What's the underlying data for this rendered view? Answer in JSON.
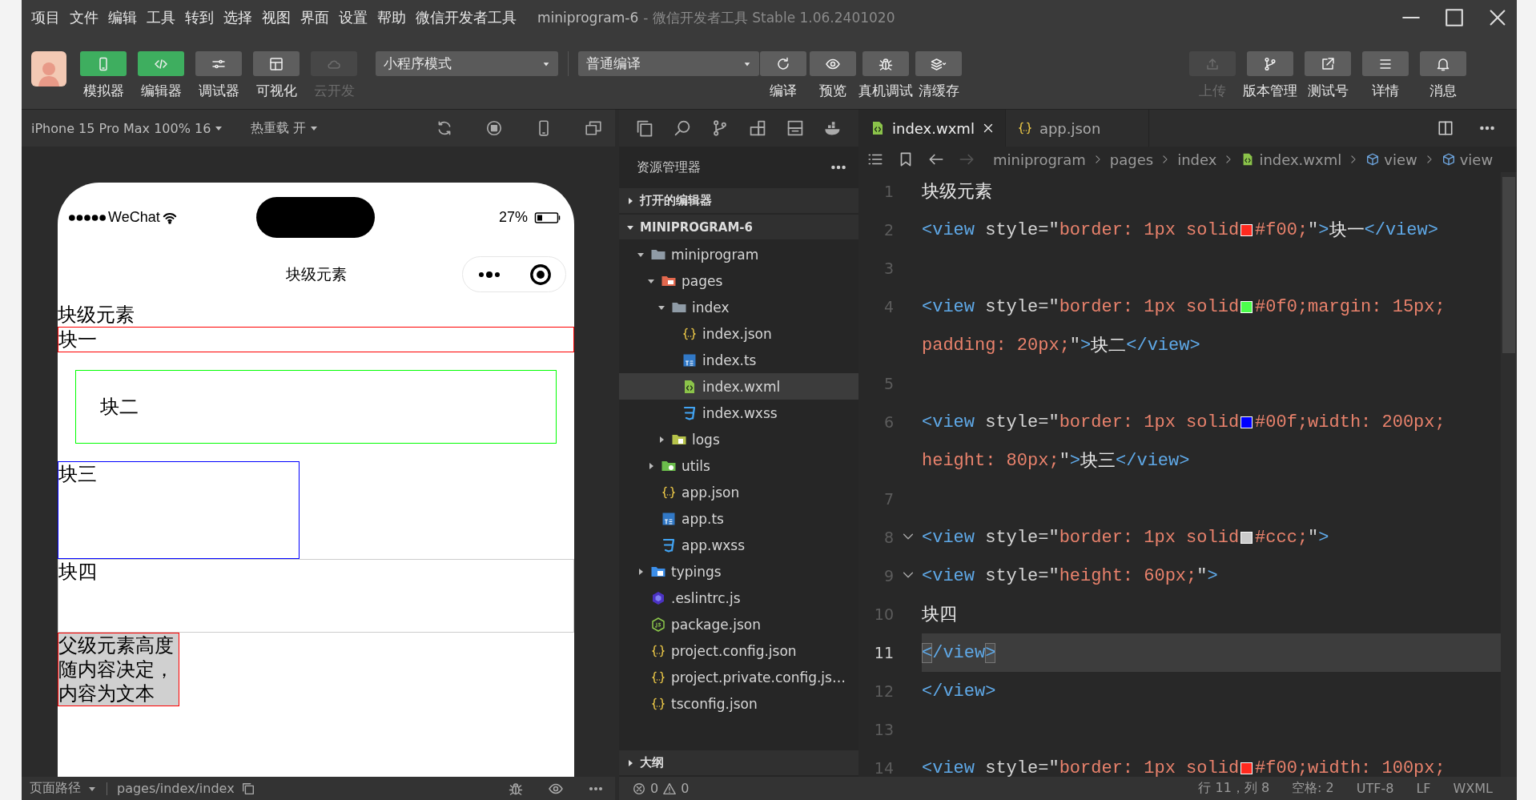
{
  "title_bar": {
    "menu": [
      "项目",
      "文件",
      "编辑",
      "工具",
      "转到",
      "选择",
      "视图",
      "界面",
      "设置",
      "帮助",
      "微信开发者工具"
    ],
    "project": "miniprogram-6",
    "app": "- 微信开发者工具 Stable 1.06.2401020"
  },
  "toolbar": {
    "view_buttons": [
      {
        "label": "模拟器",
        "kind": "phone",
        "selected": true,
        "disabled": false
      },
      {
        "label": "编辑器",
        "kind": "code",
        "selected": true,
        "disabled": false
      },
      {
        "label": "调试器",
        "kind": "debug",
        "selected": false,
        "disabled": false
      },
      {
        "label": "可视化",
        "kind": "layout",
        "selected": false,
        "disabled": false
      },
      {
        "label": "云开发",
        "kind": "cloud",
        "selected": false,
        "disabled": true
      }
    ],
    "mode": "小程序模式",
    "compile": "普通编译",
    "action_buttons": [
      {
        "label": "编译",
        "kind": "refresh"
      },
      {
        "label": "预览",
        "kind": "eye"
      },
      {
        "label": "真机调试",
        "kind": "bug"
      },
      {
        "label": "清缓存",
        "kind": "layers"
      }
    ],
    "right_buttons": [
      {
        "label": "上传",
        "kind": "upload",
        "disabled": true
      },
      {
        "label": "版本管理",
        "kind": "branch",
        "disabled": false
      },
      {
        "label": "测试号",
        "kind": "export",
        "disabled": false
      },
      {
        "label": "详情",
        "kind": "menu",
        "disabled": false
      },
      {
        "label": "消息",
        "kind": "bell",
        "disabled": false
      }
    ]
  },
  "simulator": {
    "device": "iPhone 15 Pro Max 100% 16",
    "hot_reload": "热重载 开",
    "carrier": "WeChat",
    "battery": "27%",
    "nav_title": "块级元素",
    "blocks": [
      {
        "kind": "plain",
        "text": "块级元素"
      },
      {
        "kind": "full",
        "text": "块一",
        "color": "#ff0000"
      },
      {
        "kind": "padded",
        "text": "块二",
        "color": "#00ff00"
      },
      {
        "kind": "fixed",
        "text": "块三",
        "color": "#0000ff"
      },
      {
        "kind": "tall",
        "text": "块四",
        "color": "#cccccc"
      },
      {
        "kind": "filled",
        "text": "父级元素高度随内容决定，内容为文本",
        "color": "#ff0000"
      }
    ],
    "path_label": "页面路径",
    "path": "pages/index/index"
  },
  "explorer": {
    "title": "资源管理器",
    "sections": [
      {
        "label": "打开的编辑器",
        "expanded": false
      },
      {
        "label": "MINIPROGRAM-6",
        "expanded": true,
        "children": [
          {
            "name": "miniprogram",
            "kind": "folder",
            "expanded": true,
            "selected": false,
            "children": [
              {
                "name": "pages",
                "kind": "pages",
                "expanded": true,
                "selected": false,
                "children": [
                  {
                    "name": "index",
                    "kind": "folder",
                    "expanded": true,
                    "selected": false,
                    "children": [
                      {
                        "name": "index.json",
                        "kind": "json",
                        "selected": false
                      },
                      {
                        "name": "index.ts",
                        "kind": "ts",
                        "selected": false
                      },
                      {
                        "name": "index.wxml",
                        "kind": "wxml",
                        "selected": true
                      },
                      {
                        "name": "index.wxss",
                        "kind": "wxss",
                        "selected": false
                      }
                    ]
                  },
                  {
                    "name": "logs",
                    "kind": "logs",
                    "expanded": false,
                    "selected": false
                  }
                ]
              },
              {
                "name": "utils",
                "kind": "utils",
                "expanded": false,
                "selected": false
              },
              {
                "name": "app.json",
                "kind": "json",
                "selected": false
              },
              {
                "name": "app.ts",
                "kind": "ts",
                "selected": false
              },
              {
                "name": "app.wxss",
                "kind": "wxss",
                "selected": false
              }
            ]
          },
          {
            "name": "typings",
            "kind": "typings",
            "expanded": false,
            "selected": false
          },
          {
            "name": ".eslintrc.js",
            "kind": "eslint",
            "selected": false
          },
          {
            "name": "package.json",
            "kind": "package",
            "selected": false
          },
          {
            "name": "project.config.json",
            "kind": "json",
            "selected": false
          },
          {
            "name": "project.private.config.js…",
            "kind": "json",
            "selected": false
          },
          {
            "name": "tsconfig.json",
            "kind": "json",
            "selected": false
          }
        ]
      }
    ],
    "outline": {
      "label": "大纲",
      "expanded": false
    },
    "errors": "0",
    "warnings": "0"
  },
  "editor": {
    "tabs": [
      {
        "label": "index.wxml",
        "kind": "wxml",
        "selected": true
      },
      {
        "label": "app.json",
        "kind": "json",
        "selected": false
      }
    ],
    "breadcrumb": [
      {
        "label": "miniprogram",
        "kind": "folder"
      },
      {
        "label": "pages",
        "kind": "folder"
      },
      {
        "label": "index",
        "kind": "folder"
      },
      {
        "label": "index.wxml",
        "kind": "wxml"
      },
      {
        "label": "view",
        "kind": "element"
      },
      {
        "label": "view",
        "kind": "element"
      }
    ],
    "lines": [
      {
        "number": "1",
        "current": false,
        "fold": false,
        "rows": [
          {
            "tokens": [
              {
                "kind": "text",
                "text": "块级元素"
              }
            ]
          }
        ]
      },
      {
        "number": "2",
        "current": false,
        "fold": false,
        "rows": [
          {
            "tokens": [
              {
                "kind": "tag",
                "text": "<view"
              },
              {
                "kind": "attr",
                "text": " style=\""
              },
              {
                "kind": "string",
                "text": "border: 1px solid"
              },
              {
                "kind": "swatch",
                "color": "#ff2a1f"
              },
              {
                "kind": "string",
                "text": "#f00;"
              },
              {
                "kind": "attr",
                "text": "\""
              },
              {
                "kind": "tag",
                "text": ">"
              },
              {
                "kind": "text",
                "text": "块一"
              },
              {
                "kind": "tag",
                "text": "</view>"
              }
            ]
          }
        ]
      },
      {
        "number": "3",
        "current": false,
        "fold": false
      },
      {
        "number": "4",
        "current": false,
        "fold": false,
        "rows": [
          {
            "tokens": [
              {
                "kind": "tag",
                "text": "<view"
              },
              {
                "kind": "attr",
                "text": " style=\""
              },
              {
                "kind": "string",
                "text": "border: 1px solid"
              },
              {
                "kind": "swatch",
                "color": "#4cff4c"
              },
              {
                "kind": "string",
                "text": "#0f0;margin: 15px;"
              }
            ]
          },
          {
            "tokens": [
              {
                "kind": "string",
                "text": "padding: 20px;"
              },
              {
                "kind": "attr",
                "text": "\""
              },
              {
                "kind": "tag",
                "text": ">"
              },
              {
                "kind": "text",
                "text": "块二"
              },
              {
                "kind": "tag",
                "text": "</view>"
              }
            ]
          }
        ]
      },
      {
        "number": "5",
        "current": false,
        "fold": false
      },
      {
        "number": "6",
        "current": false,
        "fold": false,
        "rows": [
          {
            "tokens": [
              {
                "kind": "tag",
                "text": "<view"
              },
              {
                "kind": "attr",
                "text": " style=\""
              },
              {
                "kind": "string",
                "text": "border: 1px solid"
              },
              {
                "kind": "swatch",
                "color": "#0000ff"
              },
              {
                "kind": "string",
                "text": "#00f;width: 200px;"
              }
            ]
          },
          {
            "tokens": [
              {
                "kind": "string",
                "text": "height: 80px;"
              },
              {
                "kind": "attr",
                "text": "\""
              },
              {
                "kind": "tag",
                "text": ">"
              },
              {
                "kind": "text",
                "text": "块三"
              },
              {
                "kind": "tag",
                "text": "</view>"
              }
            ]
          }
        ]
      },
      {
        "number": "7",
        "current": false,
        "fold": false
      },
      {
        "number": "8",
        "current": false,
        "fold": true,
        "rows": [
          {
            "tokens": [
              {
                "kind": "tag",
                "text": "<view"
              },
              {
                "kind": "attr",
                "text": " style=\""
              },
              {
                "kind": "string",
                "text": "border: 1px solid"
              },
              {
                "kind": "swatch",
                "color": "#cccccc"
              },
              {
                "kind": "string",
                "text": "#ccc;"
              },
              {
                "kind": "attr",
                "text": "\""
              },
              {
                "kind": "tag",
                "text": ">"
              }
            ]
          }
        ]
      },
      {
        "number": "9",
        "current": false,
        "fold": true,
        "rows": [
          {
            "tokens": [
              {
                "kind": "tag",
                "text": "<view"
              },
              {
                "kind": "attr",
                "text": " style=\""
              },
              {
                "kind": "string",
                "text": "height: 60px;"
              },
              {
                "kind": "attr",
                "text": "\""
              },
              {
                "kind": "tag",
                "text": ">"
              }
            ]
          }
        ]
      },
      {
        "number": "10",
        "current": false,
        "fold": false,
        "rows": [
          {
            "tokens": [
              {
                "kind": "text",
                "text": "块四"
              }
            ]
          }
        ]
      },
      {
        "number": "11",
        "current": true,
        "fold": false,
        "rows": [
          {
            "tokens": [
              {
                "kind": "tag",
                "text": "</view>"
              }
            ]
          }
        ]
      },
      {
        "number": "12",
        "current": false,
        "fold": false,
        "rows": [
          {
            "tokens": [
              {
                "kind": "tag",
                "text": "</view>"
              }
            ]
          }
        ]
      },
      {
        "number": "13",
        "current": false,
        "fold": false
      },
      {
        "number": "14",
        "current": false,
        "fold": false,
        "rows": [
          {
            "tokens": [
              {
                "kind": "tag",
                "text": "<view"
              },
              {
                "kind": "attr",
                "text": " style=\""
              },
              {
                "kind": "string",
                "text": "border: 1px solid"
              },
              {
                "kind": "swatch",
                "color": "#ff2a1f"
              },
              {
                "kind": "string",
                "text": "#f00;width: 100px;"
              }
            ]
          }
        ]
      }
    ],
    "status": [
      "行 11，列 8",
      "空格: 2",
      "UTF-8",
      "LF",
      "WXML"
    ]
  }
}
